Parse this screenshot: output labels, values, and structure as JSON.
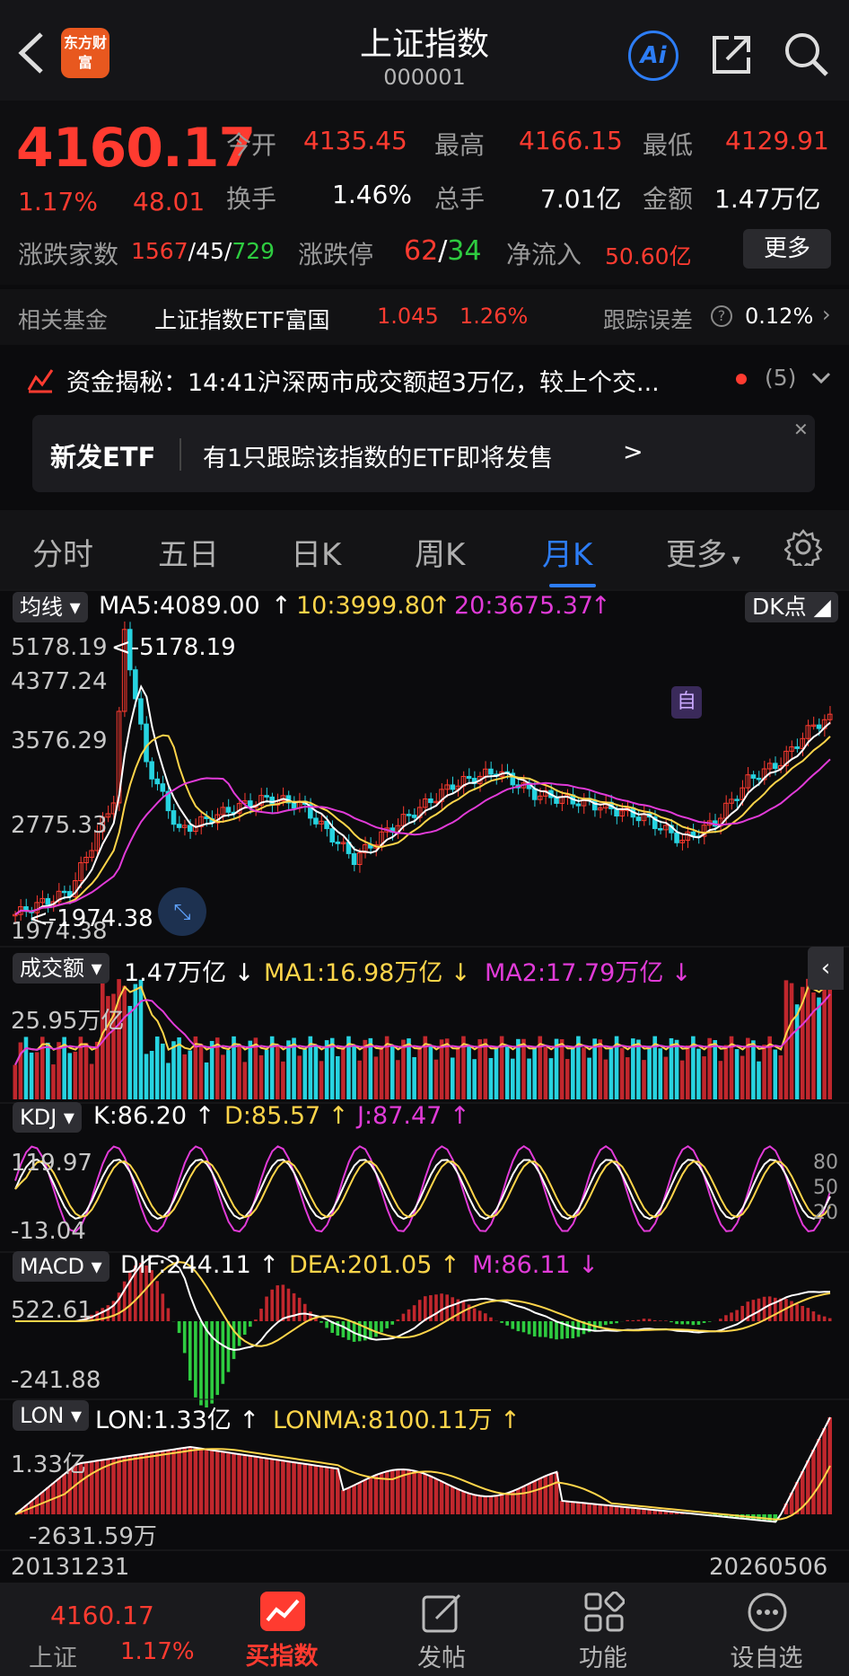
{
  "header": {
    "title": "上证指数",
    "code": "000001",
    "logo_text": "东方财富",
    "ai_label": "Ai"
  },
  "quote": {
    "price": "4160.17",
    "change_pct": "1.17%",
    "change": "48.01",
    "open_label": "今开",
    "open": "4135.45",
    "high_label": "最高",
    "high": "4166.15",
    "low_label": "最低",
    "low": "4129.91",
    "turnover_label": "换手",
    "turnover": "1.46%",
    "volume_label": "总手",
    "volume": "7.01亿",
    "amount_label": "金额",
    "amount": "1.47万亿",
    "breadth_label": "涨跌家数",
    "breadth_up": "1567",
    "breadth_flat": "45",
    "breadth_down": "729",
    "limit_label": "涨跌停",
    "limit_up": "62",
    "limit_down": "34",
    "inflow_label": "净流入",
    "inflow": "50.60亿",
    "more_label": "更多"
  },
  "fund": {
    "label": "相关基金",
    "name": "上证指数ETF富国",
    "price": "1.045",
    "pct": "1.26%",
    "track_label": "跟踪误差",
    "track_value": "0.12%"
  },
  "news": {
    "text": "资金揭秘：14:41沪深两市成交额超3万亿，较上个交...",
    "count": "(5)"
  },
  "etf_banner": {
    "tag": "新发ETF",
    "text": "有1只跟踪该指数的ETF即将发售",
    "arrow": ">"
  },
  "tabs": [
    "分时",
    "五日",
    "日K",
    "周K",
    "月K",
    "更多"
  ],
  "active_tab": "月K",
  "main_chart": {
    "selector": "均线",
    "ma5": "MA5:4089.00",
    "ma10": "10:3999.80",
    "ma20": "20:3675.37",
    "dk_button": "DK点",
    "y_labels": [
      "5178.19",
      "4377.24",
      "3576.29",
      "2775.33",
      "1974.38"
    ],
    "max_marker": "<-5178.19",
    "min_marker": "<-1974.38",
    "self_tag": "自"
  },
  "volume_panel": {
    "selector": "成交额",
    "value": "1.47万亿",
    "ma1": "MA1:16.98万亿",
    "ma2": "MA2:17.79万亿",
    "y_label": "25.95万亿"
  },
  "kdj_panel": {
    "selector": "KDJ",
    "k": "K:86.20",
    "d": "D:85.57",
    "j": "J:87.47",
    "y_top": "119.97",
    "y_bottom": "-13.04",
    "right_labels": [
      "80",
      "50",
      "20"
    ]
  },
  "macd_panel": {
    "selector": "MACD",
    "dif": "DIF:244.11",
    "dea": "DEA:201.05",
    "m": "M:86.11",
    "y_top": "522.61",
    "y_bottom": "-241.88"
  },
  "lon_panel": {
    "selector": "LON",
    "lon": "LON:1.33亿",
    "lonma": "LONMA:8100.11万",
    "y_top": "1.33亿",
    "y_bottom": "-2631.59万"
  },
  "x_axis": {
    "start": "20131231",
    "end": "20260506"
  },
  "bottom_nav": {
    "index_price": "4160.17",
    "index_name": "上证",
    "index_pct": "1.17%",
    "items": [
      "买指数",
      "发帖",
      "功能",
      "设自选"
    ]
  },
  "colors": {
    "up": "#ff3b30",
    "down": "#2ecc40",
    "accent": "#2d7df6",
    "ma10": "#ffd54a",
    "ma20": "#e13bd8"
  }
}
